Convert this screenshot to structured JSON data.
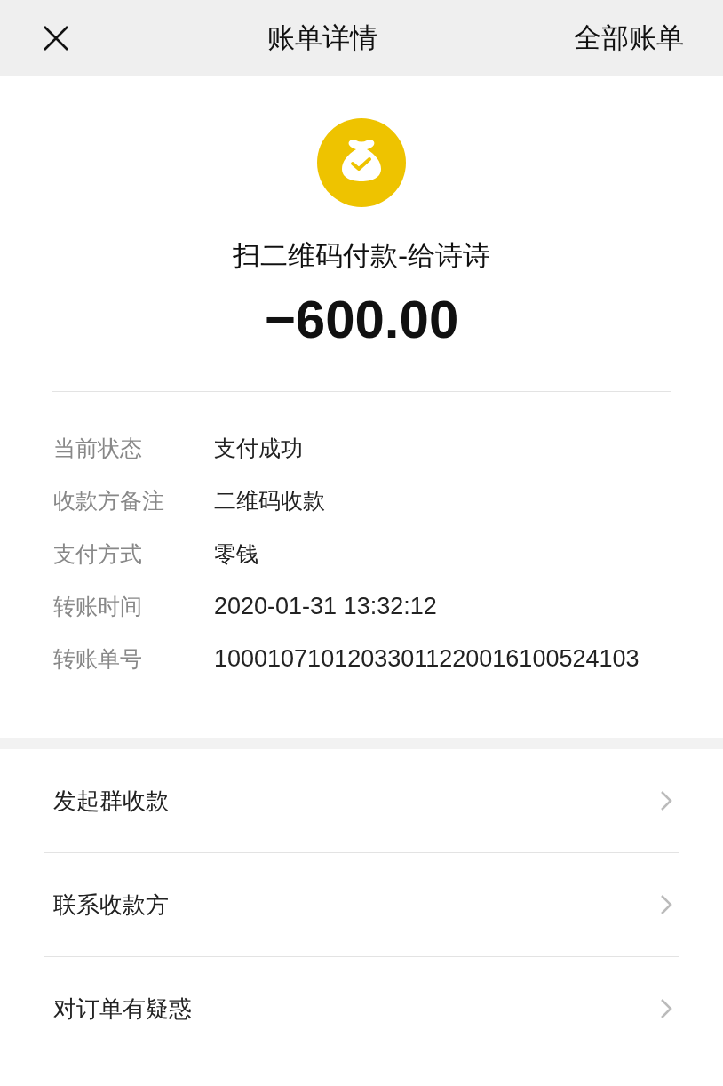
{
  "header": {
    "title": "账单详情",
    "action": "全部账单"
  },
  "summary": {
    "title": "扫二维码付款-给诗诗",
    "amount": "−600.00"
  },
  "details": [
    {
      "label": "当前状态",
      "value": "支付成功"
    },
    {
      "label": "收款方备注",
      "value": "二维码收款"
    },
    {
      "label": "支付方式",
      "value": "零钱"
    },
    {
      "label": "转账时间",
      "value": "2020-01-31 13:32:12"
    },
    {
      "label": "转账单号",
      "value": "10001071012033011220016100524103"
    }
  ],
  "actions": [
    {
      "label": "发起群收款"
    },
    {
      "label": "联系收款方"
    },
    {
      "label": "对订单有疑惑"
    }
  ]
}
